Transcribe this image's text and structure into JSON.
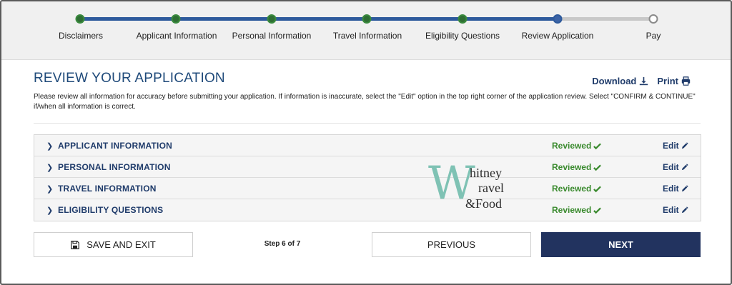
{
  "progress": {
    "steps": [
      {
        "label": "Disclaimers",
        "state": "done"
      },
      {
        "label": "Applicant Information",
        "state": "done"
      },
      {
        "label": "Personal Information",
        "state": "done"
      },
      {
        "label": "Travel Information",
        "state": "done"
      },
      {
        "label": "Eligibility Questions",
        "state": "done"
      },
      {
        "label": "Review Application",
        "state": "current"
      },
      {
        "label": "Pay",
        "state": "todo"
      }
    ]
  },
  "header": {
    "title": "REVIEW YOUR APPLICATION",
    "download_label": "Download",
    "print_label": "Print",
    "intro": "Please review all information for accuracy before submitting your application. If information is inaccurate, select the \"Edit\" option in the top right corner of the application review. Select \"CONFIRM & CONTINUE\" if/when all information is correct."
  },
  "sections": [
    {
      "title": "APPLICANT INFORMATION",
      "status": "Reviewed",
      "edit_label": "Edit"
    },
    {
      "title": "PERSONAL INFORMATION",
      "status": "Reviewed",
      "edit_label": "Edit"
    },
    {
      "title": "TRAVEL INFORMATION",
      "status": "Reviewed",
      "edit_label": "Edit"
    },
    {
      "title": "ELIGIBILITY QUESTIONS",
      "status": "Reviewed",
      "edit_label": "Edit"
    }
  ],
  "watermark": {
    "initial": "W",
    "line1": "hitney",
    "line2": "ravel",
    "line3": "&Food"
  },
  "footer": {
    "save_label": "SAVE AND EXIT",
    "step_text": "Step 6 of 7",
    "previous_label": "PREVIOUS",
    "next_label": "NEXT"
  },
  "colors": {
    "accent_navy": "#22335f",
    "title_blue": "#1f4a7a",
    "reviewed_green": "#3a8a2e",
    "progress_blue": "#2e5a9c",
    "watermark_teal": "#7fc2b4"
  },
  "icons": {
    "download": "download-icon",
    "print": "printer-icon",
    "reviewed": "checkmark-icon",
    "edit": "pencil-icon",
    "save": "floppy-disk-icon",
    "expand": "chevron-right-icon"
  }
}
